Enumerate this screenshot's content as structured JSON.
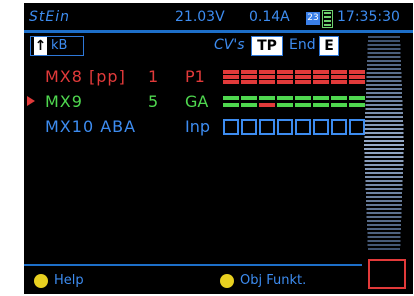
{
  "status_bar": {
    "name": "StEin",
    "voltage": "21.03V",
    "current": "0.14A",
    "badge": "23",
    "time": "17:35:30"
  },
  "toolbar": {
    "arrow_icon": "up-arrow-icon",
    "unit": "kB",
    "cvs_label": "CV's",
    "tp_label": "TP",
    "end_label": "End",
    "end_key": "E"
  },
  "locos": [
    {
      "name": "MX8 [pp]",
      "address": "1",
      "mode": "P1",
      "color": "#e23a3a",
      "cells": [
        1,
        1,
        1,
        1,
        1,
        1,
        1,
        1
      ]
    },
    {
      "name": "MX9",
      "address": "5",
      "mode": "GA",
      "color": "#4fd84f",
      "selected": true,
      "cells": [
        2,
        2,
        3,
        2,
        2,
        2,
        2,
        2
      ]
    },
    {
      "name": "MX10 ABA",
      "address": "",
      "mode": "Inp",
      "color": "#3d8cf0",
      "cells": [
        0,
        0,
        0,
        0,
        0,
        0,
        0,
        0
      ]
    }
  ],
  "bottom": {
    "help_label": "Help",
    "obj_label": "Obj Funkt.",
    "help_icon": "circle-key-icon",
    "obj_icon": "circle-key-icon"
  },
  "colors": {
    "accent": "#3d8cf0",
    "red": "#e23a3a",
    "green": "#4fd84f",
    "yellow": "#e8d020"
  }
}
